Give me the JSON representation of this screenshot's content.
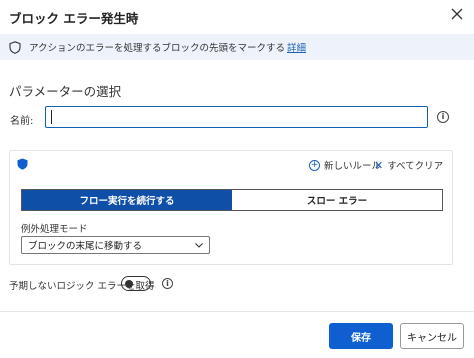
{
  "dialog": {
    "title": "ブロック エラー発生時",
    "info_text": "アクションのエラーを処理するブロックの先頭をマークする",
    "info_link": "詳細"
  },
  "parameters": {
    "section_title": "パラメーターの選択",
    "name_label": "名前:",
    "name_value": ""
  },
  "panel": {
    "new_rule_label": "新しいルール",
    "clear_all_label": "すべてクリア",
    "tabs": [
      {
        "label": "フロー実行を続行する",
        "active": true
      },
      {
        "label": "スロー エラー",
        "active": false
      }
    ],
    "mode_label": "例外処理モード",
    "mode_value": "ブロックの末尾に移動する"
  },
  "toggle": {
    "label": "予期しないロジック エラーを取得",
    "on": false
  },
  "footer": {
    "save_label": "保存",
    "cancel_label": "キャンセル"
  },
  "colors": {
    "accent": "#0f5fd0",
    "active_tab": "#0f4fa8",
    "info_bar": "#eef3fb",
    "link": "#1a5fb4"
  }
}
